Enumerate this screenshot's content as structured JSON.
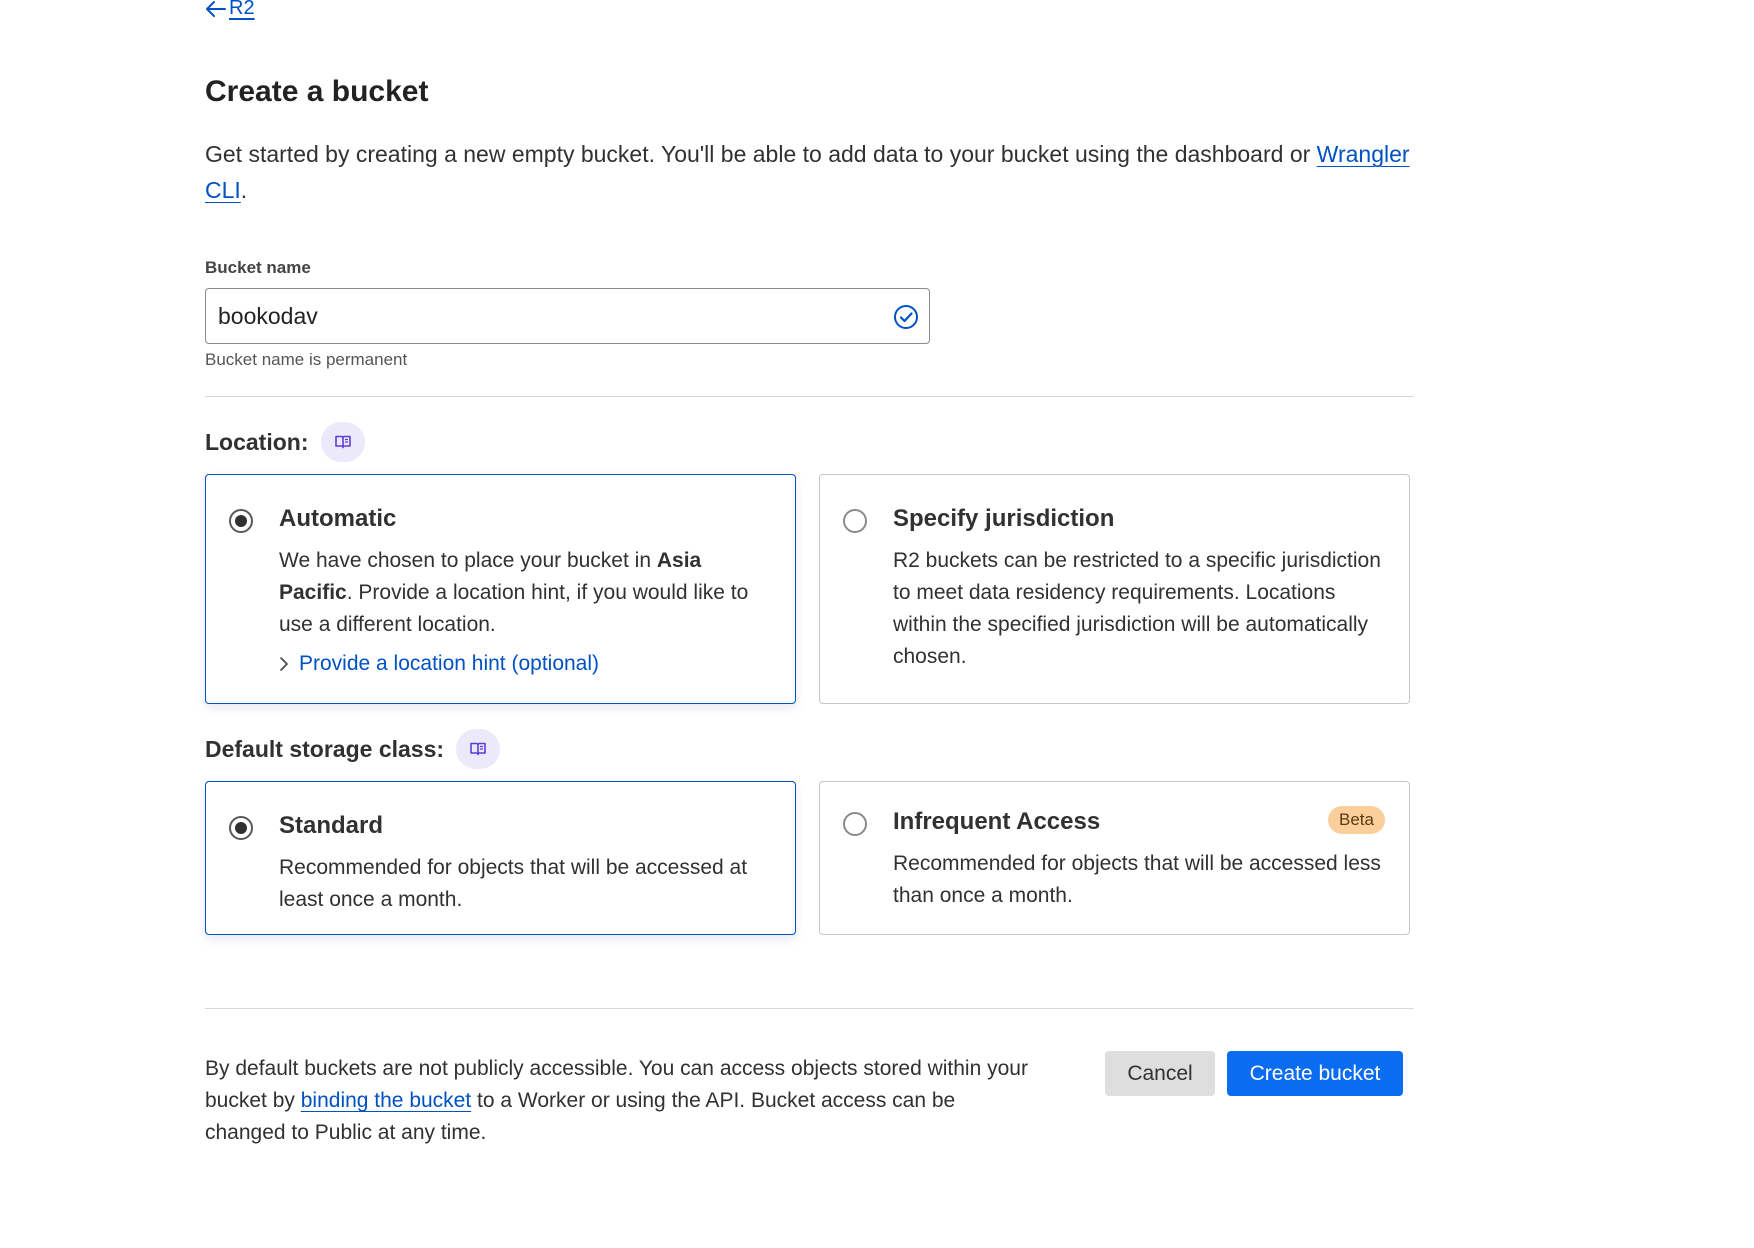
{
  "breadcrumb": {
    "back_label": "R2",
    "back_icon": "arrow-left-icon"
  },
  "page": {
    "title": "Create a bucket",
    "intro_text": "Get started by creating a new empty bucket. You'll be able to add data to your bucket using the dashboard or ",
    "intro_link": "Wrangler CLI",
    "intro_end": "."
  },
  "bucket_name": {
    "label": "Bucket name",
    "value": "bookodav",
    "helper": "Bucket name is permanent",
    "valid_icon": "check-circle-icon"
  },
  "location": {
    "label": "Location:",
    "doc_icon": "book-icon",
    "options": [
      {
        "title": "Automatic",
        "selected": true,
        "body_before": "We have chosen to place your bucket in ",
        "body_bold": "Asia Pacific",
        "body_after": ". Provide a location hint, if you would like to use a different location.",
        "link": "Provide a location hint (optional)"
      },
      {
        "title": "Specify jurisdiction",
        "selected": false,
        "body": "R2 buckets can be restricted to a specific jurisdiction to meet data residency requirements. Locations within the specified jurisdiction will be automatically chosen."
      }
    ]
  },
  "storage_class": {
    "label": "Default storage class:",
    "doc_icon": "book-icon",
    "options": [
      {
        "title": "Standard",
        "selected": true,
        "body": "Recommended for objects that will be accessed at least once a month."
      },
      {
        "title": "Infrequent Access",
        "selected": false,
        "badge": "Beta",
        "body": "Recommended for objects that will be accessed less than once a month."
      }
    ]
  },
  "footer": {
    "text_before": "By default buckets are not publicly accessible. You can access objects stored within your bucket by ",
    "link": "binding the bucket",
    "text_after": " to a Worker or using the API. Bucket access can be changed to Public at any time."
  },
  "actions": {
    "cancel": "Cancel",
    "create": "Create bucket"
  },
  "colors": {
    "link": "#0051c3",
    "primary_button": "#0a6cf0",
    "selected_border": "#0051c3",
    "beta_badge": "#fbcf9b",
    "doc_badge": "#ece9fb"
  }
}
